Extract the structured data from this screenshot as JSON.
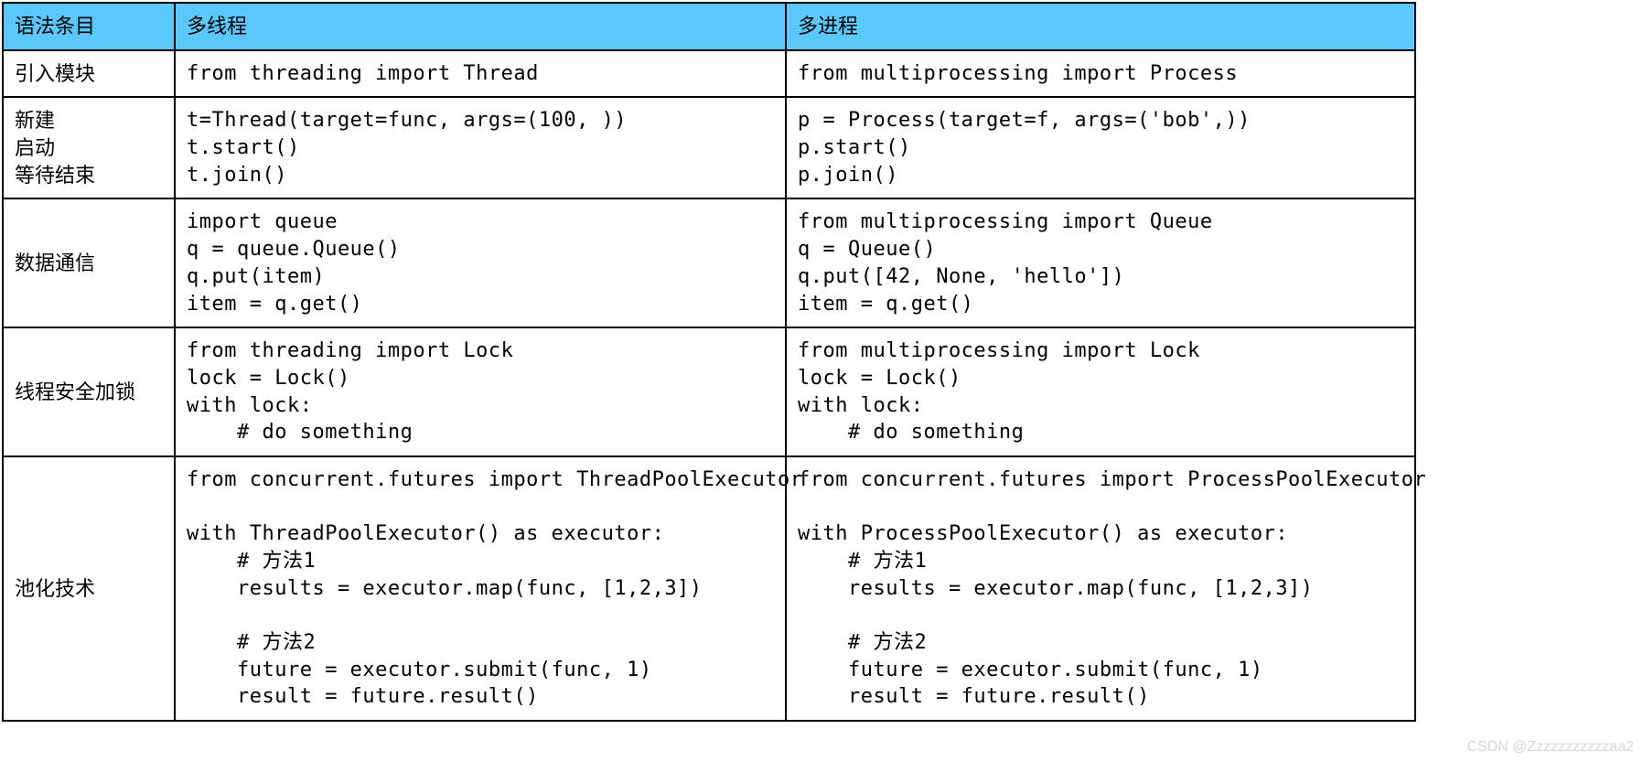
{
  "headers": {
    "col1": "语法条目",
    "col2": "多线程",
    "col3": "多进程"
  },
  "rows": [
    {
      "label": "引入模块",
      "thread": "from threading import Thread",
      "process": "from multiprocessing import Process"
    },
    {
      "label": "新建\n启动\n等待结束",
      "thread": "t=Thread(target=func, args=(100, ))\nt.start()\nt.join()",
      "process": "p = Process(target=f, args=('bob',))\np.start()\np.join()"
    },
    {
      "label": "数据通信",
      "thread": "import queue\nq = queue.Queue()\nq.put(item)\nitem = q.get()",
      "process": "from multiprocessing import Queue\nq = Queue()\nq.put([42, None, 'hello'])\nitem = q.get()"
    },
    {
      "label": "线程安全加锁",
      "thread": "from threading import Lock\nlock = Lock()\nwith lock:\n    # do something",
      "process": "from multiprocessing import Lock\nlock = Lock()\nwith lock:\n    # do something"
    },
    {
      "label": "池化技术",
      "thread": "from concurrent.futures import ThreadPoolExecutor\n\nwith ThreadPoolExecutor() as executor:\n    # 方法1\n    results = executor.map(func, [1,2,3])\n\n    # 方法2\n    future = executor.submit(func, 1)\n    result = future.result()",
      "process": "from concurrent.futures import ProcessPoolExecutor\n\nwith ProcessPoolExecutor() as executor:\n    # 方法1\n    results = executor.map(func, [1,2,3])\n\n    # 方法2\n    future = executor.submit(func, 1)\n    result = future.result()"
    }
  ],
  "watermark": "CSDN @Zzzzzzzzzzzaa2"
}
